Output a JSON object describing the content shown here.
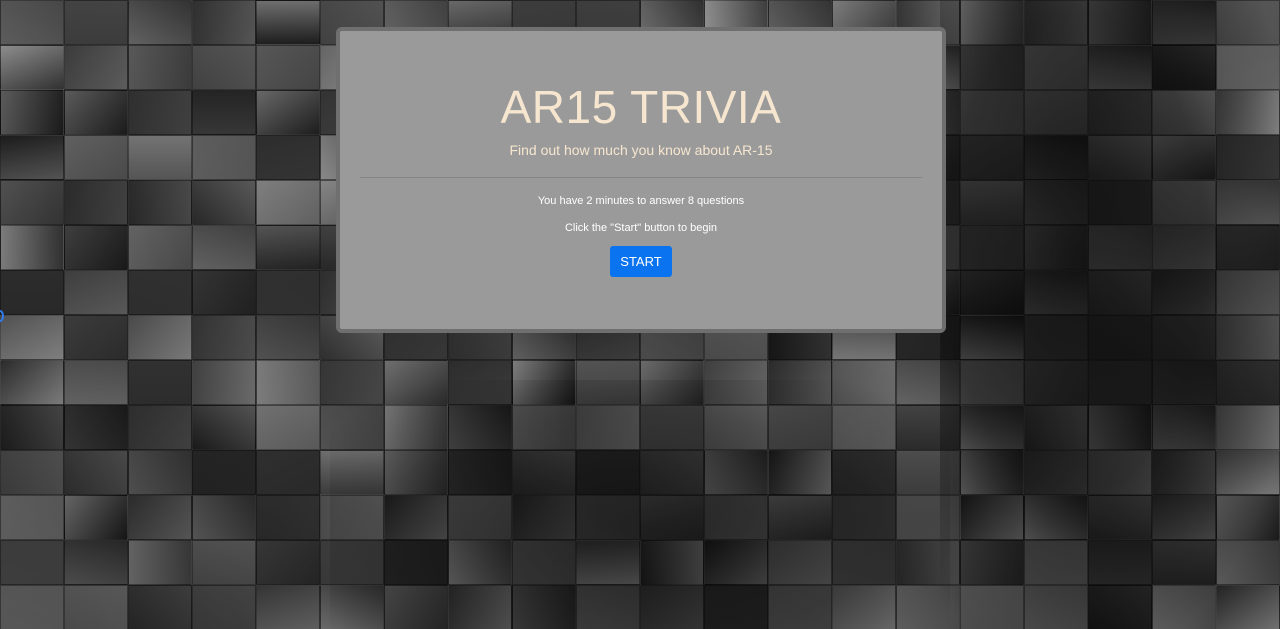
{
  "quiz": {
    "title": "AR15 TRIVIA",
    "subtitle": "Find out how much you know about AR-15",
    "instructions": "You have 2 minutes to answer 8 questions",
    "start_prompt": "Click the \"Start\" button to begin",
    "start_button_label": "START"
  },
  "colors": {
    "title_text": "#f6e6cf",
    "card_background": "#9a9a9a",
    "button_background": "#0a73f0"
  }
}
